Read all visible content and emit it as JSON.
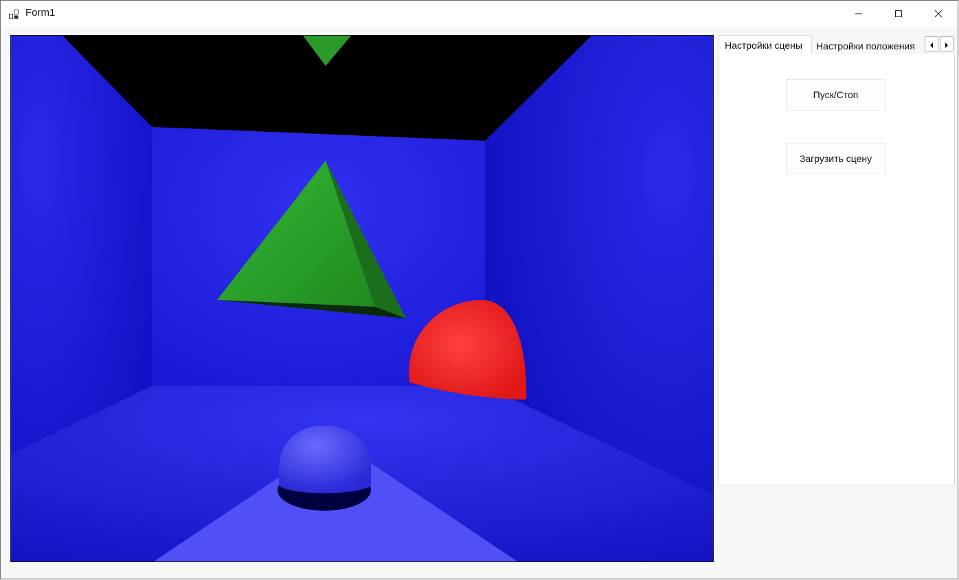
{
  "window": {
    "title": "Form1",
    "icons": {
      "app": "form-icon",
      "minimize": "minimize-icon",
      "maximize": "maximize-icon",
      "close": "close-icon"
    }
  },
  "viewport": {
    "scene": "rendered-3d-scene",
    "colors": {
      "walls": "#1a1ae6",
      "ceiling": "#000000",
      "pyramid": "#2aa02a",
      "red_sphere": "#ff2a2a",
      "blue_sphere": "#4a4aff"
    }
  },
  "tabs": {
    "items": [
      {
        "label": "Настройки сцены",
        "active": true
      },
      {
        "label": "Настройки положения",
        "active": false
      }
    ],
    "scroll_icons": [
      "chevron-left-icon",
      "chevron-right-icon"
    ]
  },
  "buttons": {
    "run_label": "Пуск/Стоп",
    "load_label": "Загрузить сцену"
  }
}
